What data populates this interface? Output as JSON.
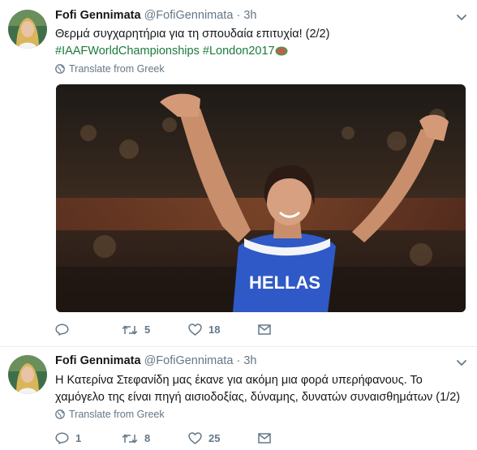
{
  "tweets": [
    {
      "author_name": "Fofi Gennimata",
      "author_handle": "@FofiGennimata",
      "separator": "·",
      "time": "3h",
      "text_line1": "Θερμά συγχαρητήρια για τη σπουδαία επιτυχία! (2/2)",
      "hashtag1": "#IAAFWorldChampionships",
      "hashtag2": "#London2017",
      "translate_label": "Translate from Greek",
      "media_text": "HELLAS",
      "reply_count": "",
      "retweet_count": "5",
      "like_count": "18"
    },
    {
      "author_name": "Fofi Gennimata",
      "author_handle": "@FofiGennimata",
      "separator": "·",
      "time": "3h",
      "text_line1": "Η Κατερίνα Στεφανίδη μας έκανε για ακόμη μια φορά υπερήφανους. Το",
      "text_line2": "χαμόγελο της είναι πηγή αισιοδοξίας, δύναμης, δυνατών συναισθημάτων (1/2)",
      "translate_label": "Translate from Greek",
      "reply_count": "1",
      "retweet_count": "8",
      "like_count": "25"
    }
  ],
  "icons": {
    "globe": "globe-icon",
    "reply": "reply-icon",
    "retweet": "retweet-icon",
    "like": "heart-icon",
    "dm": "envelope-icon",
    "caret": "chevron-down-icon",
    "emoji": "medal-emoji-icon"
  },
  "colors": {
    "hashtag": "#1b7a3c",
    "muted": "#657786",
    "text": "#14171a"
  }
}
